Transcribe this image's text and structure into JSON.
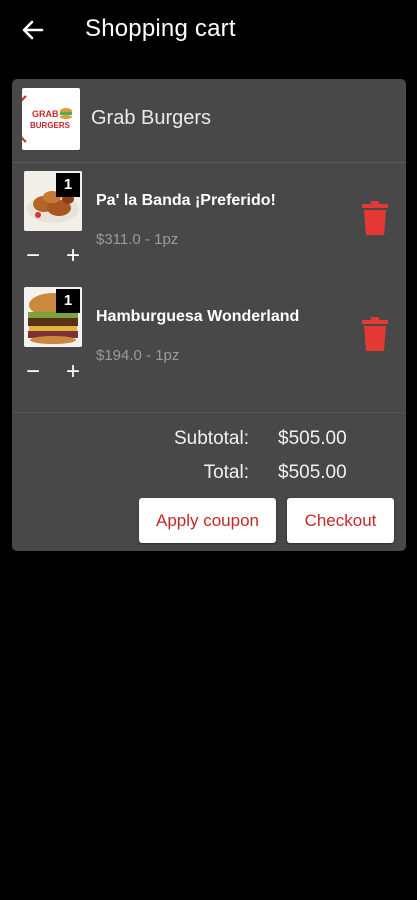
{
  "header": {
    "title": "Shopping cart",
    "back_icon": "arrow-left-icon"
  },
  "cart": {
    "restaurant": {
      "name": "Grab Burgers",
      "logo_text_line1": "GRAB",
      "logo_text_line2": "BURGERS"
    },
    "items": [
      {
        "name": "Pa' la Banda ¡Preferido!",
        "price": "$311.0 - 1pz",
        "quantity": "1",
        "image": "fried-chicken-plate"
      },
      {
        "name": "Hamburguesa Wonderland",
        "price": "$194.0 - 1pz",
        "quantity": "1",
        "image": "burger"
      }
    ],
    "minus_symbol": "−",
    "plus_symbol": "+",
    "summary": {
      "subtotal_label": "Subtotal:",
      "subtotal_value": "$505.00",
      "total_label": "Total:",
      "total_value": "$505.00"
    },
    "buttons": {
      "apply_coupon": "Apply coupon",
      "checkout": "Checkout"
    }
  },
  "colors": {
    "background": "#000000",
    "card": "#484848",
    "accent_red": "#e53935",
    "button_text_red": "#c62828",
    "muted_text": "#9a9a9a"
  }
}
